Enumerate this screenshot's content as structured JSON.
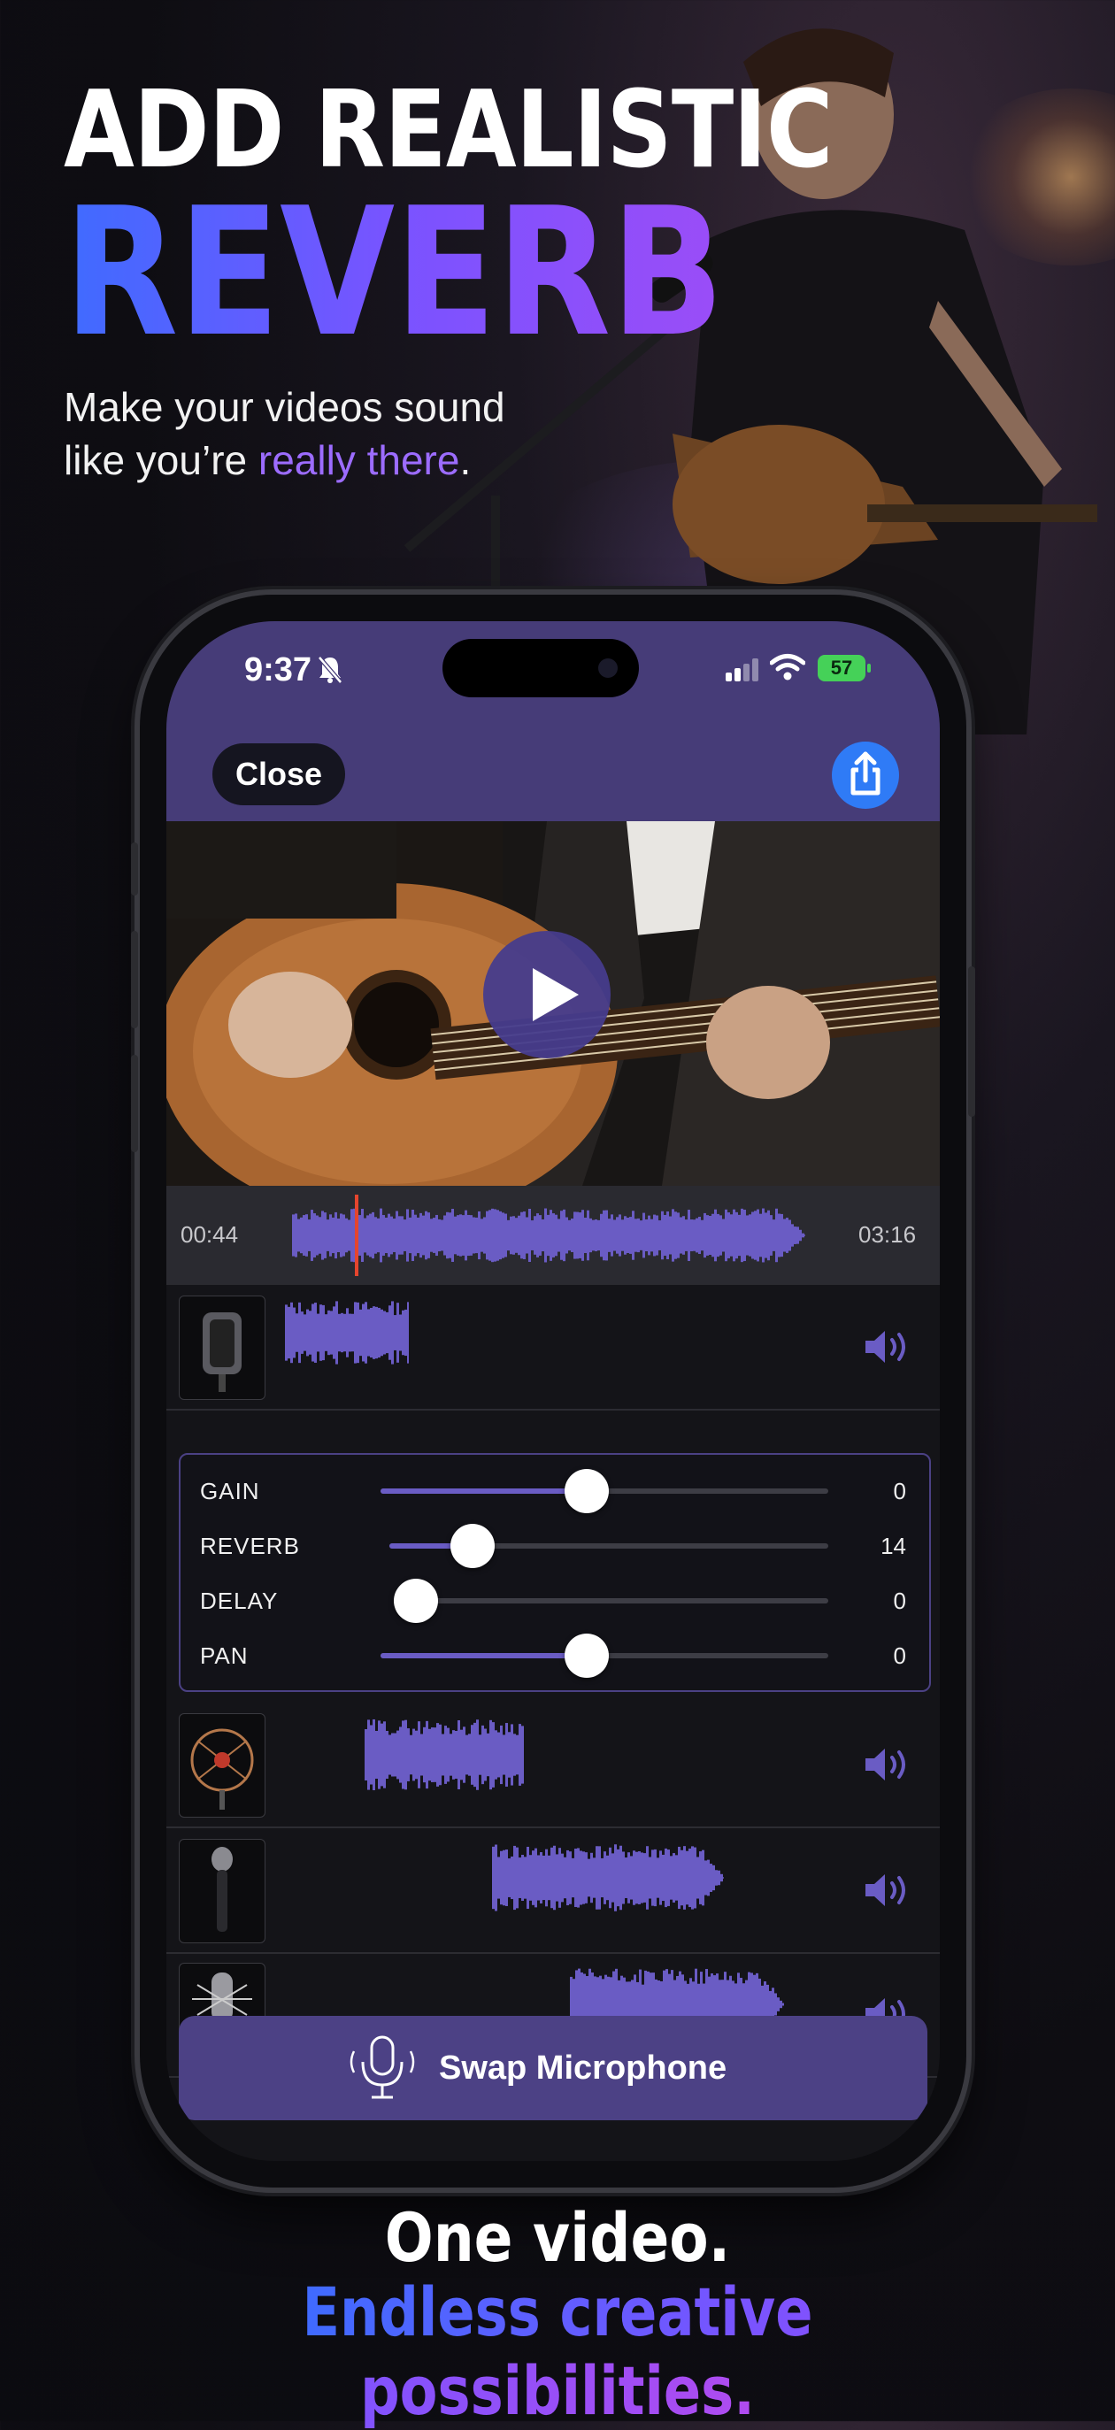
{
  "headline": {
    "line1": "ADD REALISTIC",
    "line2": "REVERB"
  },
  "subtitle": {
    "part1": "Make your videos sound",
    "part2": "like you’re ",
    "accent": "really there",
    "end": "."
  },
  "status_bar": {
    "time": "9:37",
    "battery": "57"
  },
  "nav": {
    "close_label": "Close"
  },
  "timeline": {
    "start": "00:44",
    "end": "03:16",
    "playhead_fraction": 0.13
  },
  "controls": [
    {
      "label": "GAIN",
      "value": "0",
      "level": 0.46
    },
    {
      "label": "REVERB",
      "value": "14",
      "level": 0.19
    },
    {
      "label": "DELAY",
      "value": "0",
      "level": 0.0
    },
    {
      "label": "PAN",
      "value": "0",
      "level": 0.46
    }
  ],
  "tracks": [
    {
      "name": "ribbon-microphone"
    },
    {
      "name": "condenser-shock-mount-microphone"
    },
    {
      "name": "handheld-dynamic-microphone"
    },
    {
      "name": "studio-condenser-microphone"
    }
  ],
  "swap_button": {
    "label": "Swap Microphone"
  },
  "footer": {
    "line1": "One video.",
    "line2": "Endless creative possibilities."
  },
  "colors": {
    "accent": "#463c78",
    "wave": "#6a5cc4",
    "playhead": "#e5452e",
    "share": "#2f7bf6"
  }
}
